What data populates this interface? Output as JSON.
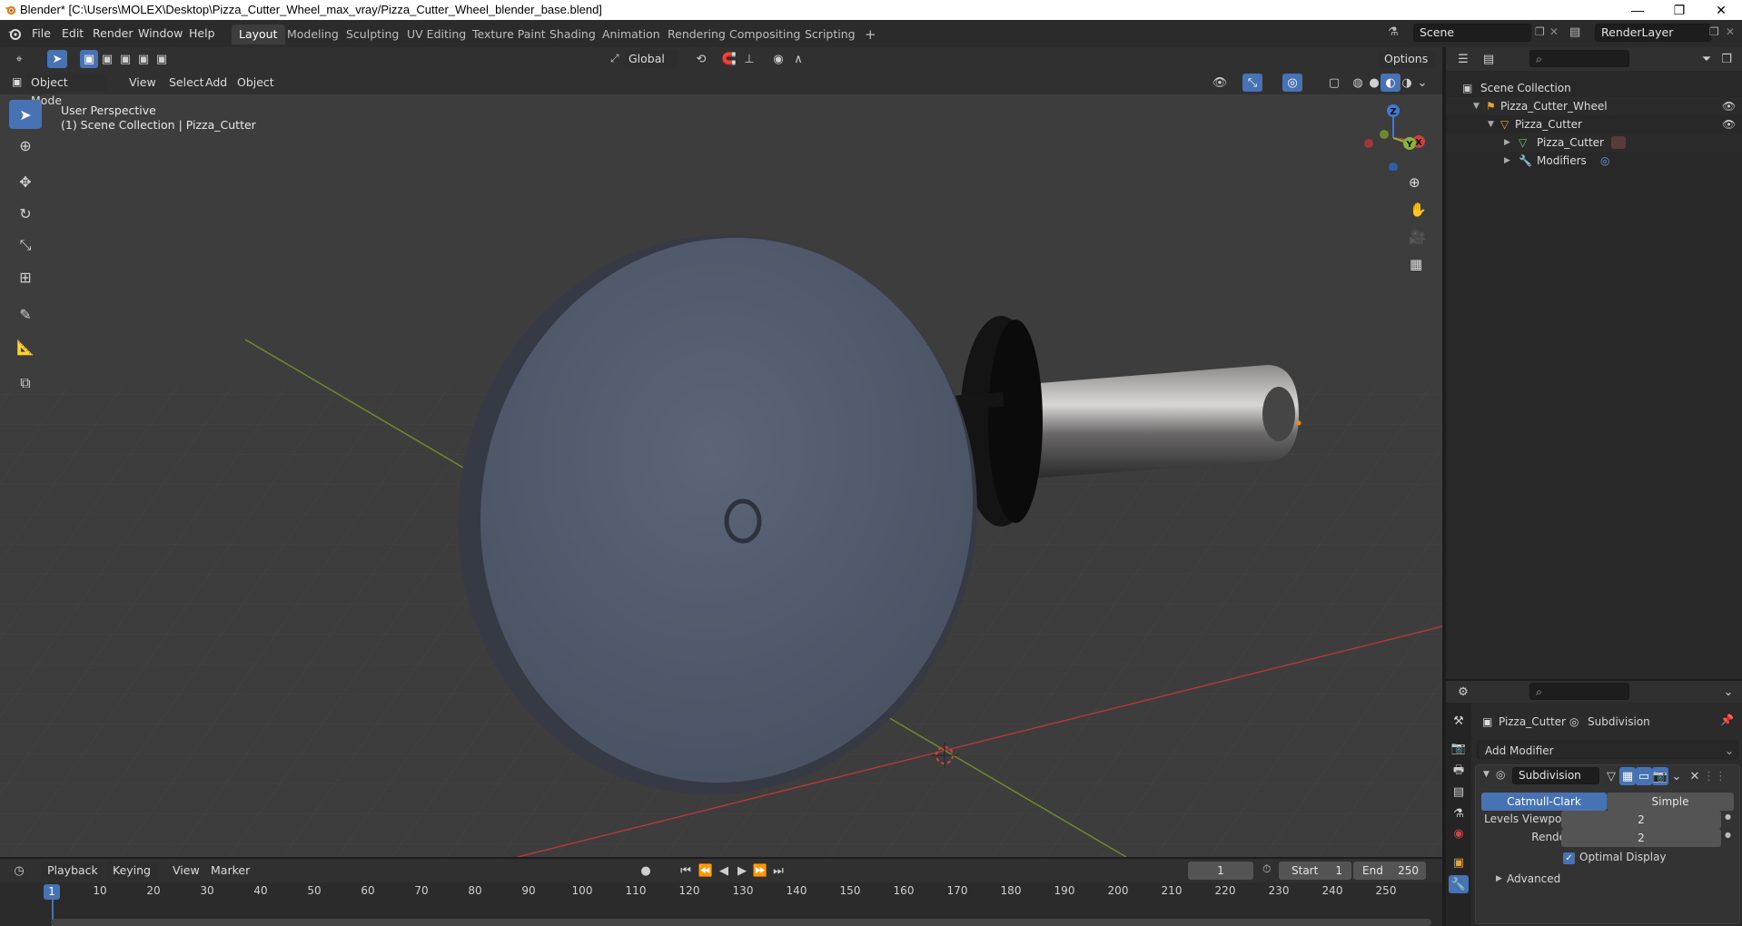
{
  "window": {
    "title": "Blender* [C:\\Users\\MOLEX\\Desktop\\Pizza_Cutter_Wheel_max_vray/Pizza_Cutter_Wheel_blender_base.blend]",
    "minimize": "—",
    "maximize": "❐",
    "close": "✕"
  },
  "menubar": {
    "items": [
      "File",
      "Edit",
      "Render",
      "Window",
      "Help"
    ],
    "workspaces": [
      "Layout",
      "Modeling",
      "Sculpting",
      "UV Editing",
      "Texture Paint",
      "Shading",
      "Animation",
      "Rendering",
      "Compositing",
      "Scripting"
    ],
    "active_workspace": "Layout",
    "add_tab": "+",
    "scene_value": "Scene",
    "view_layer_value": "RenderLayer"
  },
  "viewport_header": {
    "transform_orientation": "Global",
    "options": "Options",
    "mode": "Object Mode",
    "menus": [
      "View",
      "Select",
      "Add",
      "Object"
    ]
  },
  "viewport": {
    "view_name": "User Perspective",
    "collection_info": "(1) Scene Collection | Pizza_Cutter",
    "gizmo_labels": {
      "x": "X",
      "y": "Y",
      "z": "Z"
    }
  },
  "outliner": {
    "root": "Scene Collection",
    "rows": [
      {
        "label": "Pizza_Cutter_Wheel",
        "icon": "collection-icon"
      },
      {
        "label": "Pizza_Cutter",
        "icon": "object-icon"
      },
      {
        "label": "Pizza_Cutter",
        "icon": "mesh-icon"
      },
      {
        "label": "Modifiers",
        "icon": "wrench-icon"
      }
    ]
  },
  "properties": {
    "breadcrumb_object": "Pizza_Cutter",
    "breadcrumb_modifier": "Subdivision",
    "add_modifier": "Add Modifier",
    "modifier_name": "Subdivision",
    "algorithm_options": [
      "Catmull-Clark",
      "Simple"
    ],
    "active_algorithm": "Catmull-Clark",
    "levels_viewport_label": "Levels Viewport",
    "levels_viewport_value": "2",
    "render_label": "Render",
    "render_value": "2",
    "optimal_display_label": "Optimal Display",
    "optimal_display_checked": true,
    "advanced_label": "Advanced"
  },
  "timeline": {
    "menus": [
      "Playback",
      "Keying",
      "View",
      "Marker"
    ],
    "current_frame": "1",
    "start_label": "Start",
    "start_value": "1",
    "end_label": "End",
    "end_value": "250",
    "ruler_labels": [
      "10",
      "20",
      "30",
      "40",
      "50",
      "60",
      "70",
      "80",
      "90",
      "100",
      "110",
      "120",
      "130",
      "140",
      "150",
      "160",
      "170",
      "180",
      "190",
      "200",
      "210",
      "220",
      "230",
      "240",
      "250"
    ],
    "playhead_label": "1"
  },
  "colors": {
    "accent": "#4772b3",
    "x_axis": "#c8413f",
    "y_axis": "#8ab33a",
    "z_axis": "#3f7ad6"
  }
}
